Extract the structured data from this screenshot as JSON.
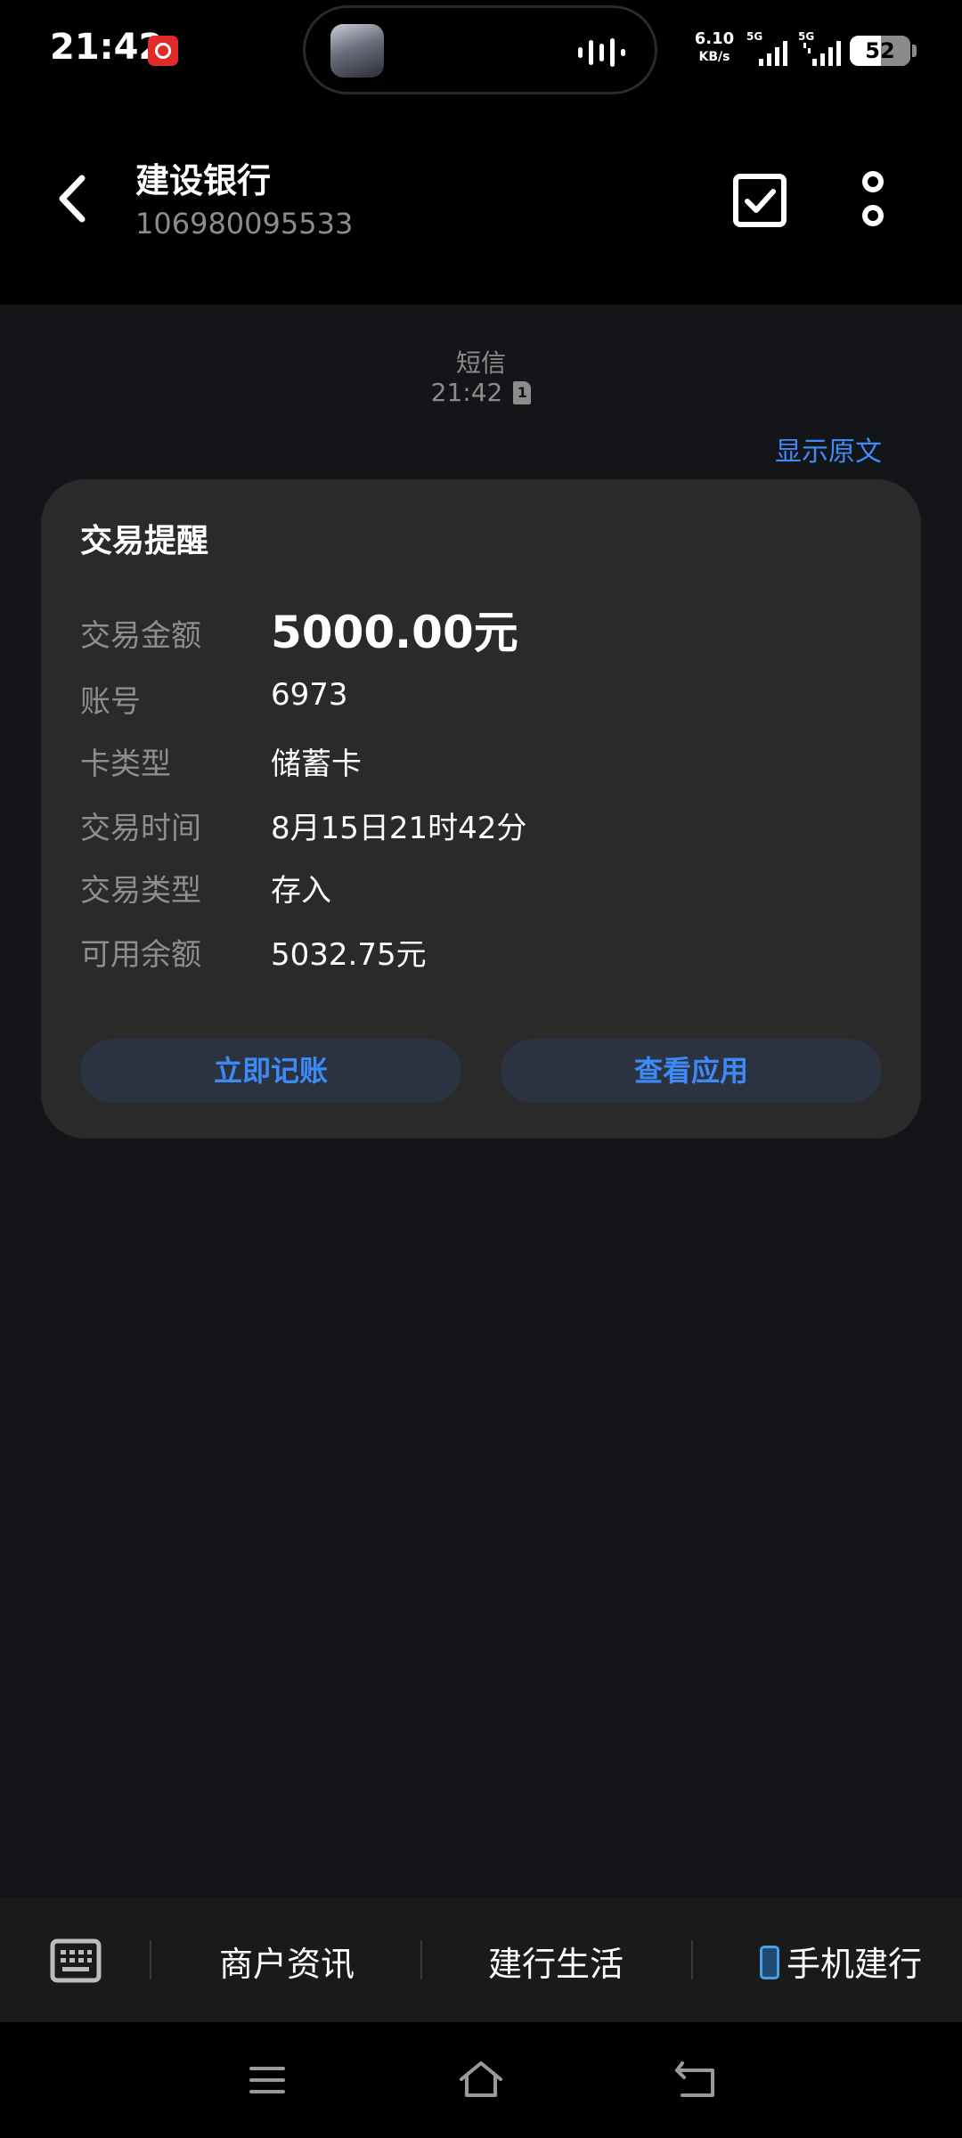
{
  "status_bar": {
    "time": "21:42",
    "net_speed_value": "6.10",
    "net_speed_unit": "KB/s",
    "sim1_generation": "5G",
    "sim2_generation": "5G",
    "battery_level": "52",
    "battery_fraction": 0.52
  },
  "header": {
    "title": "建设银行",
    "sender_number": "106980095533"
  },
  "conversation": {
    "message_type": "短信",
    "message_time": "21:42",
    "sim_slot": "1",
    "show_original_label": "显示原文"
  },
  "card": {
    "title": "交易提醒",
    "rows": [
      {
        "label": "交易金额",
        "value": "5000.00元"
      },
      {
        "label": "账号",
        "value": "6973"
      },
      {
        "label": "卡类型",
        "value": "储蓄卡"
      },
      {
        "label": "交易时间",
        "value": "8月15日21时42分"
      },
      {
        "label": "交易类型",
        "value": "存入"
      },
      {
        "label": "可用余额",
        "value": "5032.75元"
      }
    ],
    "buttons": {
      "record": "立即记账",
      "view_app": "查看应用"
    }
  },
  "menu": {
    "items": [
      "商户资讯",
      "建行生活",
      "手机建行"
    ]
  },
  "icons": {
    "back": "chevron-left-icon",
    "select": "checkbox-icon",
    "more": "more-vertical-icon",
    "keyboard": "keyboard-icon",
    "nav_menu": "menu-icon",
    "nav_home": "home-icon",
    "nav_back": "back-icon"
  },
  "colors": {
    "accent": "#3d8af7",
    "card_background": "#2a2a2b",
    "conversation_background": "#141518"
  }
}
